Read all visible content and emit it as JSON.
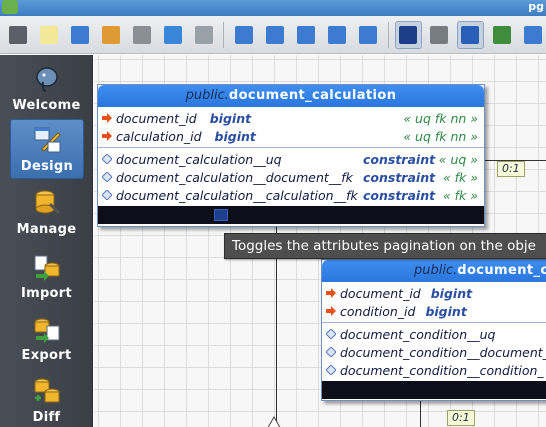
{
  "window": {
    "title": "pg"
  },
  "toolbar": {
    "buttons": [
      {
        "name": "hamburger-menu-icon",
        "color": "#5a5f68"
      },
      {
        "name": "new-model-icon",
        "color": "#f3e79a"
      },
      {
        "name": "open-folder-icon",
        "color": "#3d7bd0"
      },
      {
        "name": "recent-folder-icon",
        "color": "#e09a35"
      },
      {
        "name": "save-icon",
        "color": "#8a8f96"
      },
      {
        "name": "save-as-icon",
        "color": "#3a86d8"
      },
      {
        "name": "print-icon",
        "color": "#9aa0a8"
      },
      {
        "name": "zoom-in-icon",
        "color": "#3d7bd0"
      },
      {
        "name": "zoom-normal-icon",
        "color": "#3d7bd0"
      },
      {
        "name": "zoom-out-icon",
        "color": "#3d7bd0"
      },
      {
        "name": "zoom-fit-icon",
        "color": "#3d7bd0"
      },
      {
        "name": "align-objects-icon",
        "color": "#3d7bd0"
      },
      {
        "name": "show-grid-icon",
        "color": "#1d3f8a"
      },
      {
        "name": "show-delimiters-icon",
        "color": "#777b82"
      },
      {
        "name": "overview-icon",
        "color": "#2a5fb8"
      },
      {
        "name": "edit-icon",
        "color": "#3d8d3d"
      },
      {
        "name": "back-arrow-icon",
        "color": "#3d7bd0"
      }
    ]
  },
  "sidebar": {
    "items": [
      {
        "label": "Welcome",
        "icon": "elephant-icon",
        "active": false
      },
      {
        "label": "Design",
        "icon": "design-icon",
        "active": true
      },
      {
        "label": "Manage",
        "icon": "manage-icon",
        "active": false
      },
      {
        "label": "Import",
        "icon": "import-icon",
        "active": false
      },
      {
        "label": "Export",
        "icon": "export-icon",
        "active": false
      },
      {
        "label": "Diff",
        "icon": "diff-icon",
        "active": false
      }
    ]
  },
  "tables": [
    {
      "schema": "public.",
      "name": "document_calculation",
      "columns": [
        {
          "name": "document_id",
          "type": "bigint",
          "flags": "« uq fk nn »"
        },
        {
          "name": "calculation_id",
          "type": "bigint",
          "flags": "« uq fk nn »"
        }
      ],
      "constraints": [
        {
          "name": "document_calculation__uq",
          "type": "constraint",
          "flags": "« uq »"
        },
        {
          "name": "document_calculation__document__fk",
          "type": "constraint",
          "flags": "« fk »"
        },
        {
          "name": "document_calculation__calculation__fk",
          "type": "constraint",
          "flags": "« fk »"
        }
      ]
    },
    {
      "schema": "public.",
      "name": "document_co",
      "columns": [
        {
          "name": "document_id",
          "type": "bigint",
          "flags": ""
        },
        {
          "name": "condition_id",
          "type": "bigint",
          "flags": ""
        }
      ],
      "constraints": [
        {
          "name": "document_condition__uq",
          "type": "",
          "flags": ""
        },
        {
          "name": "document_condition__document_",
          "type": "",
          "flags": ""
        },
        {
          "name": "document_condition__condition_",
          "type": "",
          "flags": ""
        }
      ]
    }
  ],
  "relationships": [
    {
      "label": "0:1"
    },
    {
      "label": "0:1"
    }
  ],
  "tooltip": {
    "text": "Toggles the attributes pagination on the obje"
  },
  "colors": {
    "accent": "#2a78de",
    "column_marker": "#e8501a",
    "constraint_marker": "#7a94c8",
    "flag_text": "#2d8a45"
  }
}
